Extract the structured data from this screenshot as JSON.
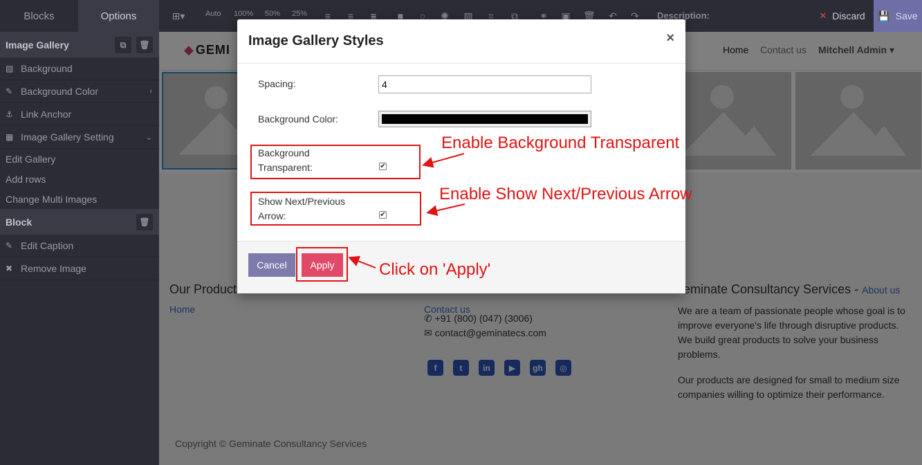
{
  "topbar": {
    "tab_blocks": "Blocks",
    "tab_options": "Options",
    "auto": "Auto",
    "w100": "100%",
    "w50": "50%",
    "w25": "25%",
    "description_label": "Description:",
    "discard": "Discard",
    "save": "Save"
  },
  "sidebar": {
    "image_gallery_head": "Image Gallery",
    "items": [
      {
        "label": "Background"
      },
      {
        "label": "Background Color"
      },
      {
        "label": "Link Anchor"
      },
      {
        "label": "Image Gallery Setting"
      }
    ],
    "sub_items": [
      {
        "label": "Edit Gallery"
      },
      {
        "label": "Add rows"
      },
      {
        "label": "Change Multi Images"
      }
    ],
    "block_head": "Block",
    "block_items": [
      {
        "label": "Edit Caption"
      },
      {
        "label": "Remove Image"
      }
    ]
  },
  "navbar": {
    "logo": "GEMI",
    "home": "Home",
    "contact": "Contact us",
    "user": "Mitchell Admin"
  },
  "footer": {
    "products_title": "Our Products",
    "home_link": "Home",
    "contact_link": "Contact us",
    "phone": "+91 (800) (047) (3006)",
    "email": "contact@geminatecs.com",
    "company_title": "eminate Consultancy Services",
    "about_link": "About us",
    "about_sep": " - ",
    "about_text": "We are a team of passionate people whose goal is to improve everyone's life through disruptive products. We build great products to solve your business problems.",
    "products_text": "Our products are designed for small to medium size companies willing to optimize their performance.",
    "copyright": "Copyright © Geminate Consultancy Services"
  },
  "modal": {
    "title": "Image Gallery Styles",
    "close": "×",
    "spacing_label": "Spacing:",
    "spacing_value": "4",
    "bgcolor_label": "Background Color:",
    "bgcolor_value": "#000000",
    "transparent_label_1": "Background",
    "transparent_label_2": "Transparent:",
    "transparent_checked": true,
    "arrow_label_1": "Show Next/Previous",
    "arrow_label_2": "Arrow:",
    "arrow_checked": true,
    "cancel": "Cancel",
    "apply": "Apply"
  },
  "annotations": {
    "transparent": "Enable Background Transparent",
    "arrow": "Enable Show Next/Previous Arrow",
    "apply": "Click on 'Apply'"
  },
  "colors": {
    "editor_dark": "#2c2c36",
    "save_accent": "#6f6fa8",
    "apply_btn": "#e04a68",
    "cancel_btn": "#7c7bab",
    "annotation_red": "#e01414",
    "link_blue": "#3a6bc4"
  }
}
